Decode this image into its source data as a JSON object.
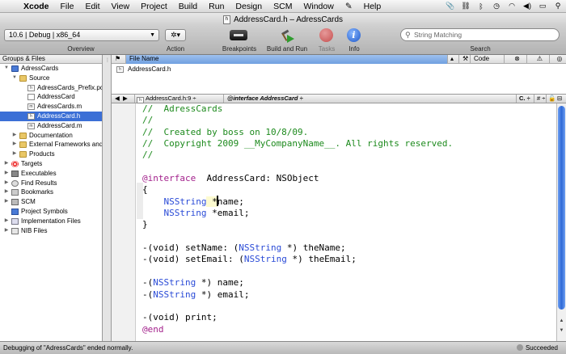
{
  "menubar": {
    "apple": "",
    "app_name": "Xcode",
    "menus": [
      "File",
      "Edit",
      "View",
      "Project",
      "Build",
      "Run",
      "Design",
      "SCM",
      "Window",
      "Help"
    ],
    "script_glyph": "✎"
  },
  "window": {
    "title": "AddressCard.h – AdressCards",
    "doc_glyph": "h"
  },
  "toolbar": {
    "overview_value": "10.6 | Debug | x86_64",
    "overview_label": "Overview",
    "action_glyph": "✲▾",
    "action_label": "Action",
    "breakpoints_label": "Breakpoints",
    "build_run_label": "Build and Run",
    "tasks_label": "Tasks",
    "info_glyph": "i",
    "info_label": "Info",
    "search_placeholder": "String Matching",
    "search_label": "Search"
  },
  "sidebar": {
    "header": "Groups & Files",
    "items": [
      {
        "label": "AdressCards",
        "level": 0,
        "disclosure": "▼",
        "icon": "app"
      },
      {
        "label": "Source",
        "level": 1,
        "disclosure": "▼",
        "icon": "folder"
      },
      {
        "label": "AdressCards_Prefix.pch",
        "level": 2,
        "disclosure": "",
        "icon": "file-h"
      },
      {
        "label": "AddressCard",
        "level": 2,
        "disclosure": "",
        "icon": "file"
      },
      {
        "label": "AdressCards.m",
        "level": 2,
        "disclosure": "",
        "icon": "file-m"
      },
      {
        "label": "AddressCard.h",
        "level": 2,
        "disclosure": "",
        "icon": "file-h",
        "selected": true
      },
      {
        "label": "AddressCard.m",
        "level": 2,
        "disclosure": "",
        "icon": "file-m"
      },
      {
        "label": "Documentation",
        "level": 1,
        "disclosure": "▶",
        "icon": "folder"
      },
      {
        "label": "External Frameworks and Libraries",
        "level": 1,
        "disclosure": "▶",
        "icon": "folder"
      },
      {
        "label": "Products",
        "level": 1,
        "disclosure": "▶",
        "icon": "folder"
      },
      {
        "label": "Targets",
        "level": 0,
        "disclosure": "▶",
        "icon": "target"
      },
      {
        "label": "Executables",
        "level": 0,
        "disclosure": "▶",
        "icon": "exec"
      },
      {
        "label": "Find Results",
        "level": 0,
        "disclosure": "▶",
        "icon": "find"
      },
      {
        "label": "Bookmarks",
        "level": 0,
        "disclosure": "▶",
        "icon": "bookmark"
      },
      {
        "label": "SCM",
        "level": 0,
        "disclosure": "▶",
        "icon": "scm"
      },
      {
        "label": "Project Symbols",
        "level": 0,
        "disclosure": "",
        "icon": "proj"
      },
      {
        "label": "Implementation Files",
        "level": 0,
        "disclosure": "▶",
        "icon": "impl"
      },
      {
        "label": "NIB Files",
        "level": 0,
        "disclosure": "▶",
        "icon": "nib"
      }
    ]
  },
  "filelist": {
    "col_glyph": "⚑",
    "col_file_name": "File Name",
    "col_tool_glyph": "⚒",
    "col_code": "Code",
    "col_error_glyph": "⊗",
    "col_warn_glyph": "⚠",
    "col_target_glyph": "◎",
    "rows": [
      {
        "name": "AddressCard.h"
      }
    ]
  },
  "navbar": {
    "back": "◀",
    "forward": "▶",
    "file_menu": "AddressCard.h:9 ÷",
    "symbol_menu": "@interface AddressCard ÷",
    "c_menu": "C. ÷",
    "hash_menu": "# ÷",
    "lock_glyph": "🔓",
    "split_glyph": "⊟"
  },
  "editor": {
    "lines": [
      [
        {
          "t": "//  AdressCards",
          "c": "comment"
        }
      ],
      [
        {
          "t": "//",
          "c": "comment"
        }
      ],
      [
        {
          "t": "//  Created by boss on 10/8/09.",
          "c": "comment"
        }
      ],
      [
        {
          "t": "//  Copyright 2009 __MyCompanyName__. All rights reserved.",
          "c": "comment"
        }
      ],
      [
        {
          "t": "//",
          "c": "comment"
        }
      ],
      [
        {
          "t": "",
          "c": "plain"
        }
      ],
      [
        {
          "t": "@interface",
          "c": "keyword"
        },
        {
          "t": "  AddressCard: NSObject",
          "c": "plain"
        }
      ],
      [
        {
          "t": "{",
          "c": "plain"
        }
      ],
      [
        {
          "t": "    ",
          "c": "plain"
        },
        {
          "t": "NSString",
          "c": "type"
        },
        {
          "t": " *",
          "c": "plain"
        },
        {
          "t": "name",
          "c": "plain"
        },
        {
          "t": ";",
          "c": "plain"
        }
      ],
      [
        {
          "t": "    ",
          "c": "plain"
        },
        {
          "t": "NSString",
          "c": "type"
        },
        {
          "t": " *",
          "c": "plain"
        },
        {
          "t": "email",
          "c": "plain"
        },
        {
          "t": ";",
          "c": "plain"
        }
      ],
      [
        {
          "t": "}",
          "c": "plain"
        }
      ],
      [
        {
          "t": "",
          "c": "plain"
        }
      ],
      [
        {
          "t": "-(void) setName: (",
          "c": "plain"
        },
        {
          "t": "NSString",
          "c": "type"
        },
        {
          "t": " *) theName;",
          "c": "plain"
        }
      ],
      [
        {
          "t": "-(void) setEmail: (",
          "c": "plain"
        },
        {
          "t": "NSString",
          "c": "type"
        },
        {
          "t": " *) theEmail;",
          "c": "plain"
        }
      ],
      [
        {
          "t": "",
          "c": "plain"
        }
      ],
      [
        {
          "t": "-(",
          "c": "plain"
        },
        {
          "t": "NSString",
          "c": "type"
        },
        {
          "t": " *) name;",
          "c": "plain"
        }
      ],
      [
        {
          "t": "-(",
          "c": "plain"
        },
        {
          "t": "NSString",
          "c": "type"
        },
        {
          "t": " *) email;",
          "c": "plain"
        }
      ],
      [
        {
          "t": "",
          "c": "plain"
        }
      ],
      [
        {
          "t": "-(void) print;",
          "c": "plain"
        }
      ],
      [
        {
          "t": "@end",
          "c": "keyword"
        }
      ]
    ]
  },
  "status": {
    "message": "Debugging of \"AdressCards\" ended normally.",
    "result": "Succeeded"
  },
  "colors": {
    "comment": "#1d8a1d",
    "keyword": "#a3228c",
    "type": "#2a4bd7",
    "selection": "#3b6fd6"
  }
}
